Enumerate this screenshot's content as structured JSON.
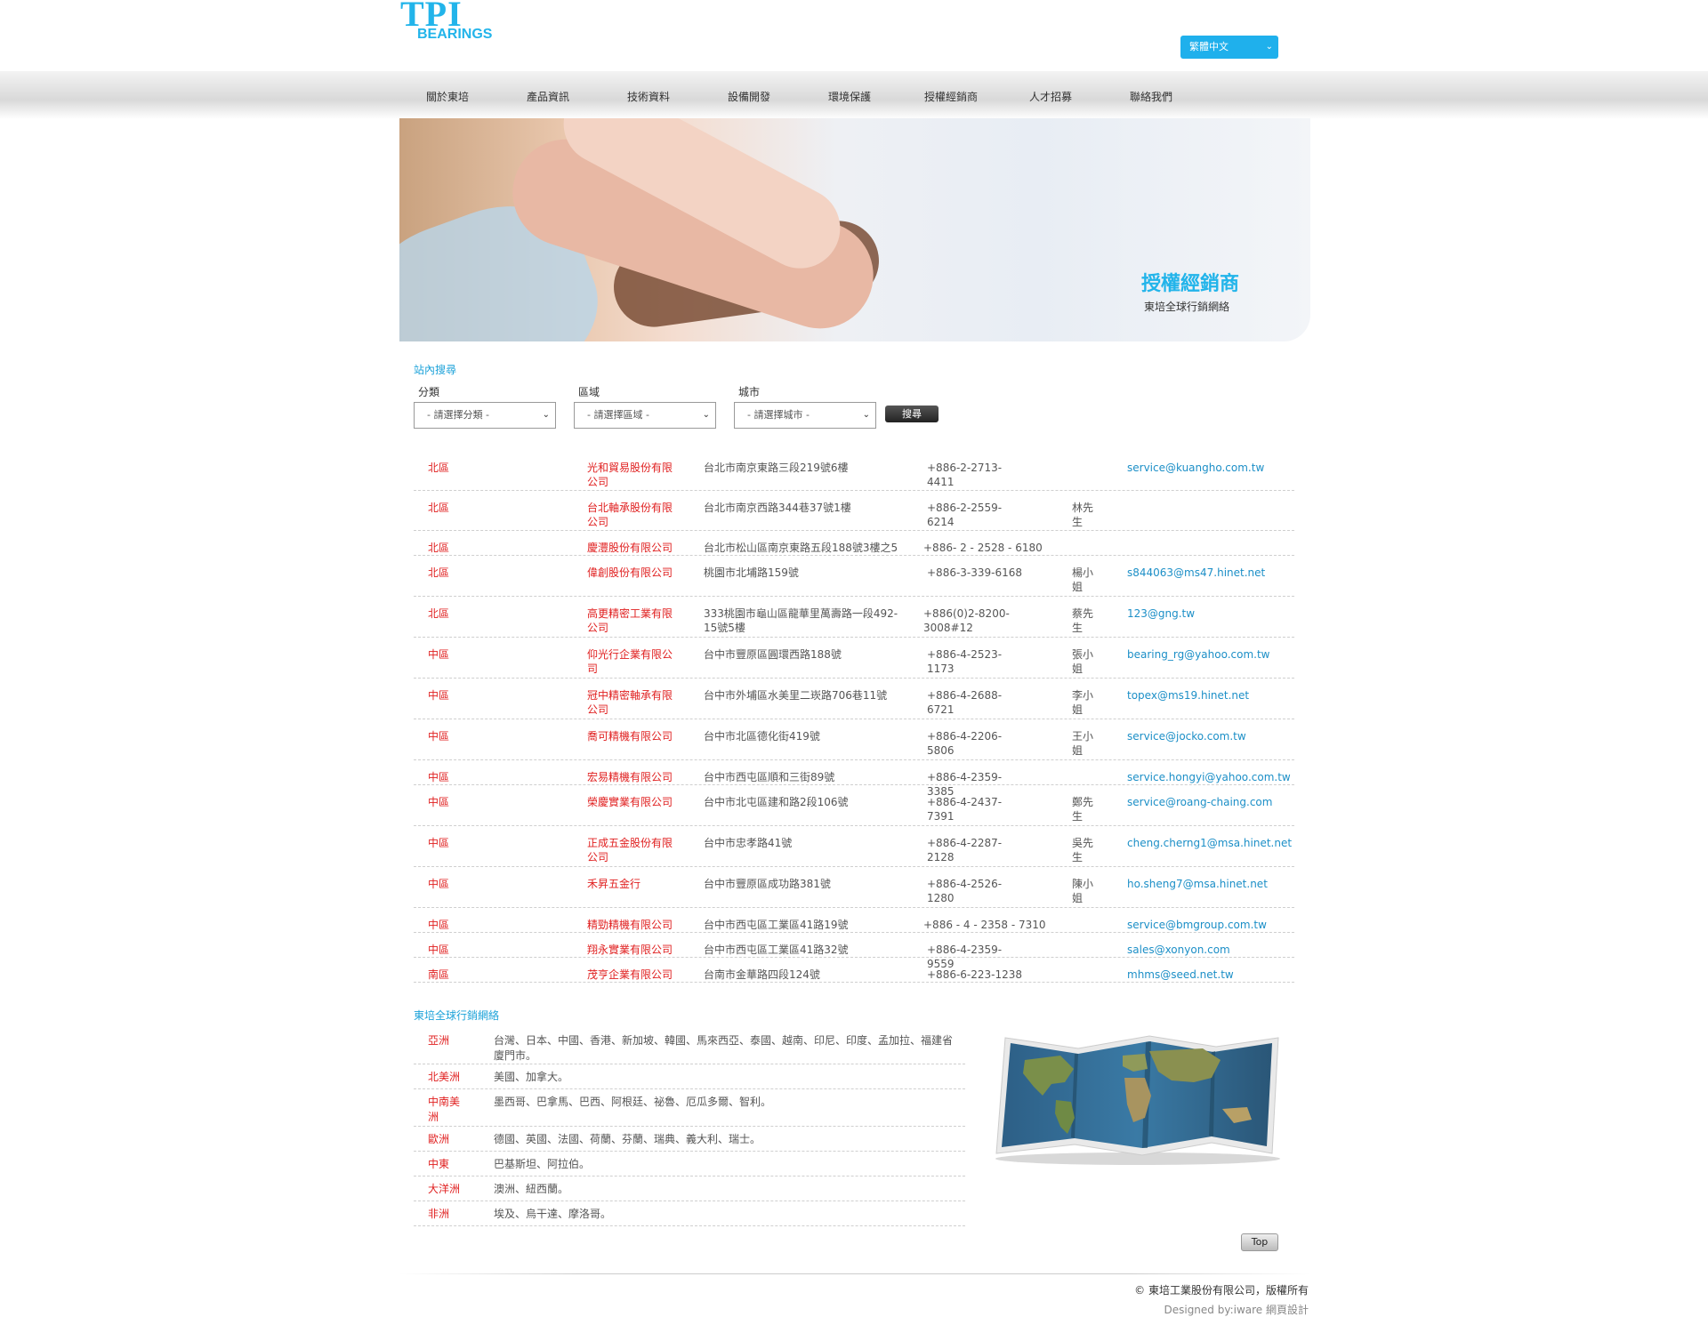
{
  "header": {
    "logo_top": "TPI",
    "logo_bottom": "BEARINGS",
    "language": "繁體中文"
  },
  "nav": [
    "關於東培",
    "產品資訊",
    "技術資料",
    "設備開發",
    "環境保護",
    "授權經銷商",
    "人才招募",
    "聯絡我們"
  ],
  "banner": {
    "title": "授權經銷商",
    "subtitle": "東培全球行銷網絡"
  },
  "search": {
    "title": "站內搜尋",
    "label_category": "分類",
    "label_region": "區域",
    "label_city": "城市",
    "select_category": "- 請選擇分類 -",
    "select_region": "- 請選擇區域 -",
    "select_city": "- 請選擇城市 -",
    "button": "搜尋"
  },
  "dealers": [
    {
      "area": "北區",
      "name": "光和貿易股份有限公司",
      "address": "台北市南京東路三段219號6樓",
      "tel": "+886-2-2713-4411",
      "contact": "",
      "email": "service@kuangho.com.tw"
    },
    {
      "area": "北區",
      "name": "台北軸承股份有限公司",
      "address": "台北市南京西路344巷37號1樓",
      "tel": "+886-2-2559-6214",
      "contact": "林先生",
      "email": ""
    },
    {
      "area": "北區",
      "name": "慶灃股份有限公司",
      "address": "台北市松山區南京東路五段188號3樓之5",
      "tel": "+886- 2 - 2528 - 6180",
      "contact": "",
      "email": ""
    },
    {
      "area": "北區",
      "name": "偉創股份有限公司",
      "address": "桃園市北埔路159號",
      "tel": "+886-3-339-6168",
      "contact": "楊小姐",
      "email": "s844063@ms47.hinet.net"
    },
    {
      "area": "北區",
      "name": "高更精密工業有限公司",
      "address": "333桃園市龜山區龍華里萬壽路一段492-15號5樓",
      "tel": "+886(0)2-8200-3008#12",
      "contact": "蔡先生",
      "email": "123@gng.tw"
    },
    {
      "area": "中區",
      "name": "仰光行企業有限公司",
      "address": "台中市豐原區圓環西路188號",
      "tel": "+886-4-2523-1173",
      "contact": "張小姐",
      "email": "bearing_rg@yahoo.com.tw"
    },
    {
      "area": "中區",
      "name": "冠中精密軸承有限公司",
      "address": "台中市外埔區水美里二崁路706巷11號",
      "tel": "+886-4-2688-6721",
      "contact": "李小姐",
      "email": "topex@ms19.hinet.net"
    },
    {
      "area": "中區",
      "name": "喬可精機有限公司",
      "address": "台中市北區德化街419號",
      "tel": "+886-4-2206-5806",
      "contact": "王小姐",
      "email": "service@jocko.com.tw"
    },
    {
      "area": "中區",
      "name": "宏易精機有限公司",
      "address": "台中市西屯區順和三街89號",
      "tel": "+886-4-2359-3385",
      "contact": "",
      "email": "service.hongyi@yahoo.com.tw"
    },
    {
      "area": "中區",
      "name": "榮慶實業有限公司",
      "address": "台中市北屯區建和路2段106號",
      "tel": "+886-4-2437-7391",
      "contact": "鄭先生",
      "email": "service@roang-chaing.com"
    },
    {
      "area": "中區",
      "name": "正成五金股份有限公司",
      "address": "台中市忠孝路41號",
      "tel": "+886-4-2287-2128",
      "contact": "吳先生",
      "email": "cheng.cherng1@msa.hinet.net"
    },
    {
      "area": "中區",
      "name": "禾昇五金行",
      "address": "台中市豐原區成功路381號",
      "tel": "+886-4-2526-1280",
      "contact": "陳小姐",
      "email": "ho.sheng7@msa.hinet.net"
    },
    {
      "area": "中區",
      "name": "精勁精機有限公司",
      "address": "台中市西屯區工業區41路19號",
      "tel": "+886 - 4 - 2358 - 7310",
      "contact": "",
      "email": "service@bmgroup.com.tw"
    },
    {
      "area": "中區",
      "name": "翔永實業有限公司",
      "address": "台中市西屯區工業區41路32號",
      "tel": "+886-4-2359-9559",
      "contact": "",
      "email": "sales@xonyon.com"
    },
    {
      "area": "南區",
      "name": "茂亨企業有限公司",
      "address": "台南市金華路四段124號",
      "tel": "+886-6-223-1238",
      "contact": "",
      "email": "mhms@seed.net.tw"
    }
  ],
  "global": {
    "title": "東培全球行銷網絡",
    "rows": [
      {
        "region": "亞洲",
        "countries": "台灣、日本、中國、香港、新加坡、韓國、馬來西亞、泰國、越南、印尼、印度、孟加拉、福建省廈門市。"
      },
      {
        "region": "北美洲",
        "countries": "美國、加拿大。"
      },
      {
        "region": "中南美洲",
        "countries": "墨西哥、巴拿馬、巴西、阿根廷、祕魯、厄瓜多爾、智利。"
      },
      {
        "region": "歐洲",
        "countries": "德國、英國、法國、荷蘭、芬蘭、瑞典、義大利、瑞士。"
      },
      {
        "region": "中東",
        "countries": "巴基斯坦、阿拉伯。"
      },
      {
        "region": "大洋洲",
        "countries": "澳洲、紐西蘭。"
      },
      {
        "region": "非洲",
        "countries": "埃及、烏干達、摩洛哥。"
      }
    ]
  },
  "footer": {
    "top_button": "Top",
    "copyright": "© 東培工業股份有限公司，版權所有",
    "designed": "Designed by:iware 網頁設計"
  }
}
